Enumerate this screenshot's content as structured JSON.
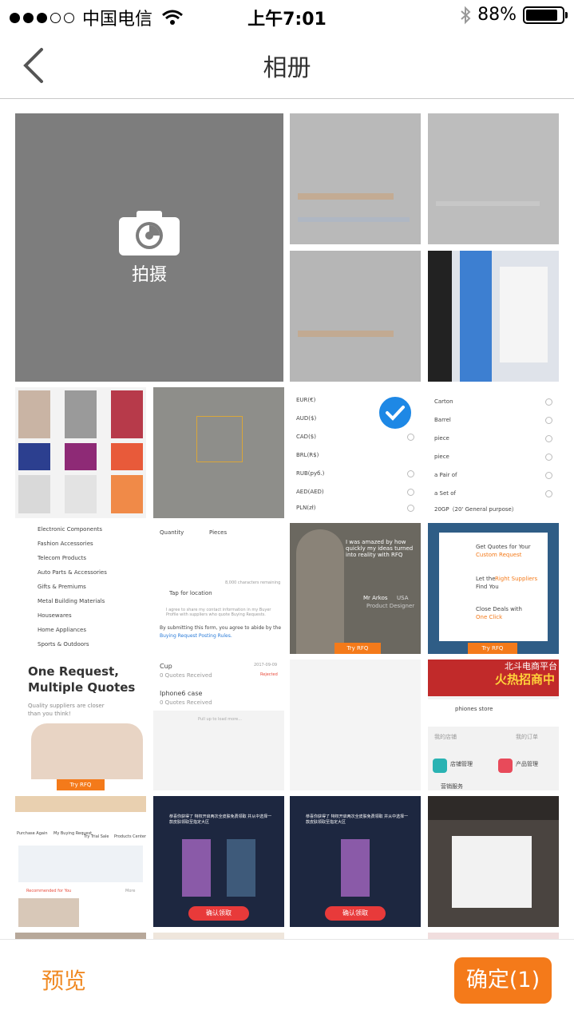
{
  "status_bar": {
    "carrier": "中国电信",
    "time": "上午7:01",
    "battery_percent": "88%",
    "battery_level": 0.88,
    "signal_bars": 2
  },
  "nav": {
    "title": "相册",
    "back_icon": "chevron-left-icon"
  },
  "grid": {
    "camera_label": "拍摄",
    "selected_index": 8,
    "thumbnails": {
      "t3": {
        "rows": [
          "EUR(€)",
          "AUD($)",
          "CAD($)",
          "BRL(R$)",
          "RUB(руб.)",
          "AED(AED)",
          "PLN(zł)"
        ]
      },
      "t4": {
        "rows": [
          "Carton",
          "Barrel",
          "piece",
          "piece",
          "a Pair of",
          "a Set of",
          "20GP（20' General purpose）"
        ]
      },
      "t5": {
        "rows": [
          "Electronic Components",
          "Fashion Accessories",
          "Telecom Products",
          "Auto Parts & Accessories",
          "Gifts & Premiums",
          "Metal Building Materials",
          "Housewares",
          "Home Appliances",
          "Sports & Outdoors"
        ]
      },
      "t6": {
        "quantity": "Quantity",
        "pieces": "Pieces",
        "chars": "8,000 characters remaining",
        "location": "Tap for location",
        "agree": "I agree to share my contact information in my Buyer Profile with suppliers who quote Buying Requests.",
        "submit": "By submitting this form, you agree to abide by the",
        "rules": "Buying Request Posting Rules."
      },
      "t7": {
        "quote": "I was amazed by how quickly my ideas turned into reality with RFQ",
        "name": "Mr Arkos",
        "country": "USA",
        "role": "Product Designer",
        "button": "Try RFQ"
      },
      "t8": {
        "a1": "Get Quotes for Your",
        "a2": "Custom Request",
        "b1": "Let the",
        "b2": "Right Suppliers",
        "b3": "Find You",
        "c1": "Close Deals with",
        "c2": "One Click",
        "button": "Try RFQ"
      },
      "t9": {
        "h1": "One Request,",
        "h2": "Multiple Quotes",
        "sub1": "Quality suppliers are closer",
        "sub2": "than you think!",
        "button": "Try RFQ"
      },
      "t10": {
        "item1": "Cup",
        "item1_sub": "0 Quotes Received",
        "item2": "Iphone6 case",
        "item2_sub": "0 Quotes Received",
        "status": "Rejected",
        "date": "2017-09-09",
        "more": "Pull up to load more..."
      },
      "t12": {
        "banner1": "北斗电商平台",
        "banner2": "火热招商中",
        "store": "phiones store",
        "m1": "我的店铺",
        "m2": "我的订单",
        "m3": "店铺管理",
        "m4": "产品管理",
        "m5": "营销服务"
      },
      "t13": {
        "n1": "Purchase Again",
        "n2": "My Buying Request",
        "n3": "Try Trial Sale",
        "n4": "Products Center",
        "rec": "Recommended for You",
        "more": "More"
      },
      "t14": {
        "text": "恭喜你获得了 特权开启两次全皮肤免费领取 并从中选择一款皮肤领取至指定大区",
        "button": "确认领取"
      }
    }
  },
  "bottom_bar": {
    "preview_label": "预览",
    "confirm_label": "确定(1)"
  },
  "colors": {
    "accent_orange": "#f47a1a",
    "preview_text": "#f08a24",
    "check_blue": "#1e88e5",
    "camera_tile": "#7d7d7d"
  }
}
